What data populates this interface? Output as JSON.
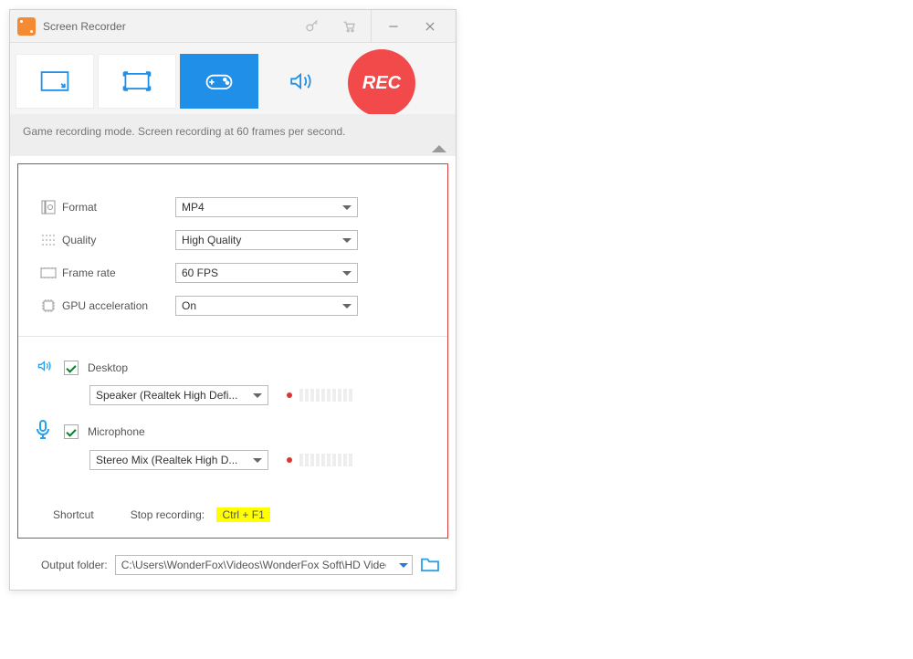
{
  "titlebar": {
    "title": "Screen Recorder"
  },
  "moderow": {
    "rec_label": "REC"
  },
  "modedesc": {
    "text": "Game recording mode. Screen recording at 60 frames per second."
  },
  "settings": {
    "format": {
      "label": "Format",
      "value": "MP4"
    },
    "quality": {
      "label": "Quality",
      "value": "High Quality"
    },
    "framerate": {
      "label": "Frame rate",
      "value": "60 FPS"
    },
    "gpu": {
      "label": "GPU acceleration",
      "value": "On"
    }
  },
  "audio": {
    "desktop": {
      "label": "Desktop",
      "device": "Speaker (Realtek High Defi..."
    },
    "microphone": {
      "label": "Microphone",
      "device": "Stereo Mix (Realtek High D..."
    }
  },
  "shortcut": {
    "label": "Shortcut",
    "stop_label": "Stop recording:",
    "key": "Ctrl + F1"
  },
  "footer": {
    "label": "Output folder:",
    "path": "C:\\Users\\WonderFox\\Videos\\WonderFox Soft\\HD Video"
  }
}
